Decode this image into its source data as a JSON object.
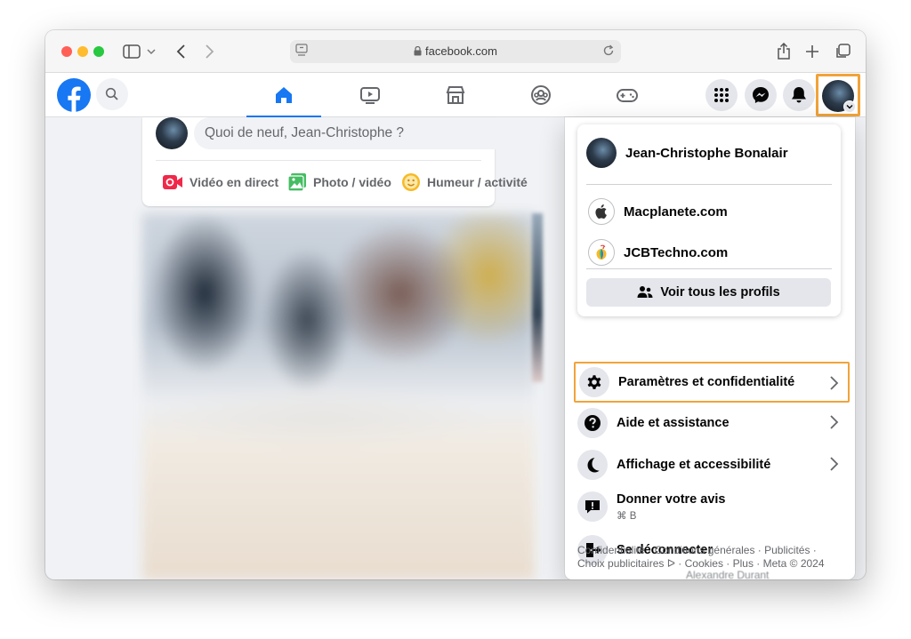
{
  "browser": {
    "url": "facebook.com"
  },
  "composer": {
    "placeholder": "Quoi de neuf, Jean-Christophe ?",
    "actions": [
      {
        "label": "Vidéo en direct",
        "color": "#f02849"
      },
      {
        "label": "Photo / vidéo",
        "color": "#45bd62"
      },
      {
        "label": "Humeur / activité",
        "color": "#f7b928"
      }
    ]
  },
  "menu": {
    "profiles": [
      {
        "name": "Jean-Christophe Bonalair"
      },
      {
        "name": "Macplanete.com"
      },
      {
        "name": "JCBTechno.com"
      }
    ],
    "see_all_label": "Voir tous les profils",
    "items": [
      {
        "label": "Paramètres et confidentialité",
        "icon": "gear-icon"
      },
      {
        "label": "Aide et assistance",
        "icon": "question-icon"
      },
      {
        "label": "Affichage et accessibilité",
        "icon": "moon-icon"
      },
      {
        "label": "Donner votre avis",
        "sub": "⌘ B",
        "icon": "feedback-icon"
      },
      {
        "label": "Se déconnecter",
        "icon": "logout-icon"
      }
    ],
    "footer_line1": "Confidentialité · Conditions générales · Publicités ·",
    "footer_line2": "Choix publicitaires ᐅ · Cookies · Plus · Meta © 2024"
  },
  "behind_panel_name": "Alexandre Durant",
  "colors": {
    "fb_blue": "#1877f2",
    "highlight": "#f1a33a"
  }
}
